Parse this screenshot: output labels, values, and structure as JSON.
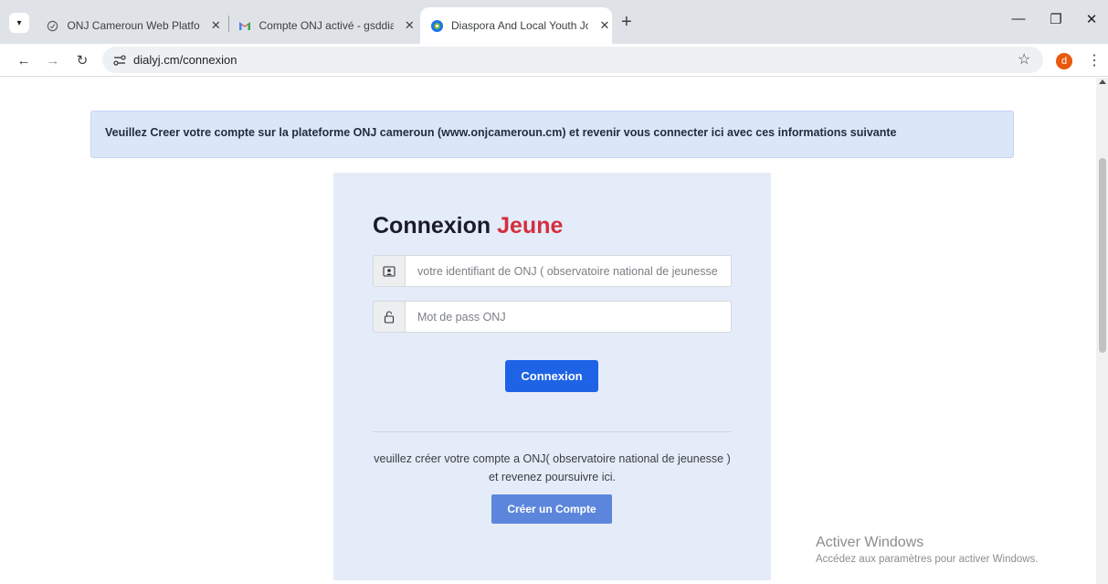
{
  "browser": {
    "tabs": [
      {
        "title": "ONJ Cameroun Web Platform",
        "active": false
      },
      {
        "title": "Compte ONJ activé - gsddialyj@",
        "active": false
      },
      {
        "title": "Diaspora And Local Youth Joint",
        "active": true
      }
    ],
    "tab_close_glyph": "✕",
    "new_tab_glyph": "+",
    "url": "dialyj.cm/connexion",
    "profile_initial": "d",
    "window_controls": {
      "minimize": "—",
      "restore": "❐",
      "close": "✕"
    }
  },
  "page": {
    "alert_text": "Veuillez Creer votre compte sur la plateforme ONJ cameroun (www.onjcameroun.cm) et revenir vous connecter ici avec ces informations suivante",
    "login": {
      "title_main": "Connexion",
      "title_accent": "Jeune",
      "identifier_placeholder": "votre identifiant de ONJ ( observatoire national de jeunesse )",
      "password_placeholder": "Mot de pass ONJ",
      "submit_label": "Connexion",
      "hint_text": "veuillez créer votre compte a ONJ( observatoire national de jeunesse ) et revenez poursuivre ici.",
      "create_account_label": "Créer un Compte"
    },
    "watermark": {
      "title": "Activer Windows",
      "subtitle": "Accédez aux paramètres pour activer Windows."
    }
  },
  "colors": {
    "accent_red": "#d32f3e",
    "primary_blue": "#1e63e6",
    "secondary_blue": "#5b86dc",
    "alert_bg": "#dbe6f9",
    "card_bg": "#e5ecf9"
  }
}
